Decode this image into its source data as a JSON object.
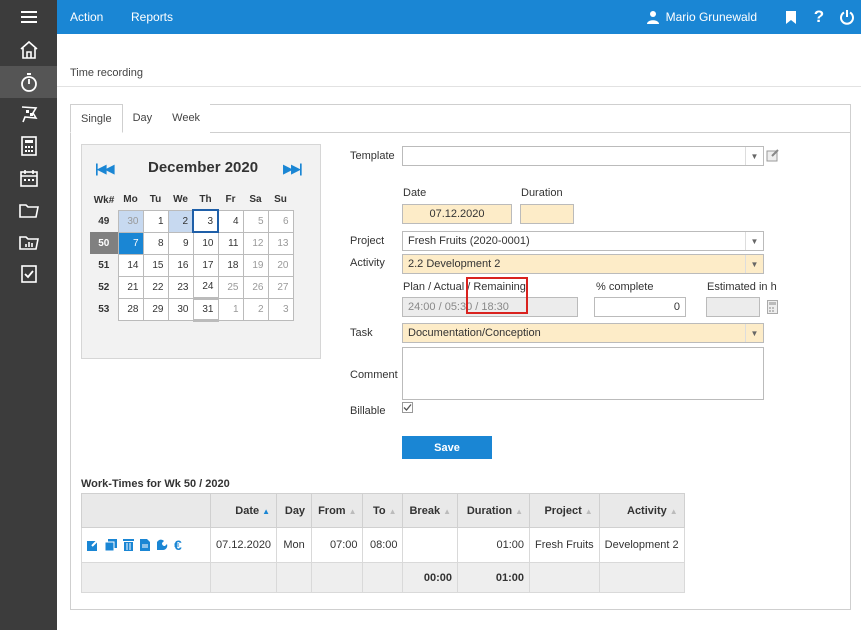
{
  "topbar": {
    "menu": [
      "Action",
      "Reports"
    ],
    "user": "Mario Grunewald"
  },
  "breadcrumb": "Time recording",
  "tabs": [
    "Single",
    "Day",
    "Week"
  ],
  "calendar": {
    "month_title": "December 2020",
    "headers": [
      "Wk#",
      "Mo",
      "Tu",
      "We",
      "Th",
      "Fr",
      "Sa",
      "Su"
    ],
    "rows": [
      {
        "wk": "49",
        "days": [
          "30",
          "1",
          "2",
          "3",
          "4",
          "5",
          "6"
        ]
      },
      {
        "wk": "50",
        "days": [
          "7",
          "8",
          "9",
          "10",
          "11",
          "12",
          "13"
        ]
      },
      {
        "wk": "51",
        "days": [
          "14",
          "15",
          "16",
          "17",
          "18",
          "19",
          "20"
        ]
      },
      {
        "wk": "52",
        "days": [
          "21",
          "22",
          "23",
          "24",
          "25",
          "26",
          "27"
        ]
      },
      {
        "wk": "53",
        "days": [
          "28",
          "29",
          "30",
          "31",
          "1",
          "2",
          "3"
        ]
      }
    ]
  },
  "form": {
    "template_label": "Template",
    "template_value": "",
    "date_label": "Date",
    "date_value": "07.12.2020",
    "duration_label": "Duration",
    "duration_value": "",
    "project_label": "Project",
    "project_value": "Fresh Fruits (2020-0001)",
    "activity_label": "Activity",
    "activity_value": "2.2 Development 2",
    "plan_label": "Plan / Actual / Remaining",
    "plan_value": "24:00 / 05:30 / 18:30",
    "complete_label": "% complete",
    "complete_value": "0",
    "estimated_label": "Estimated in h",
    "estimated_value": "",
    "task_label": "Task",
    "task_value": "Documentation/Conception",
    "comment_label": "Comment",
    "comment_value": "",
    "billable_label": "Billable",
    "save_label": "Save"
  },
  "worktimes": {
    "title": "Work-Times for Wk 50 / 2020",
    "columns": [
      "Date",
      "Day",
      "From",
      "To",
      "Break",
      "Duration",
      "Project",
      "Activity"
    ],
    "rows": [
      {
        "date": "07.12.2020",
        "day": "Mon",
        "from": "07:00",
        "to": "08:00",
        "break": "",
        "duration": "01:00",
        "project": "Fresh Fruits",
        "activity": "Development 2"
      }
    ],
    "totals": {
      "break": "00:00",
      "duration": "01:00"
    },
    "action_currency": "€"
  },
  "colors": {
    "accent": "#1a86d4",
    "rail": "#3c3c3c",
    "highlight": "#d9221e",
    "field_yellow": "#fdecc8"
  }
}
